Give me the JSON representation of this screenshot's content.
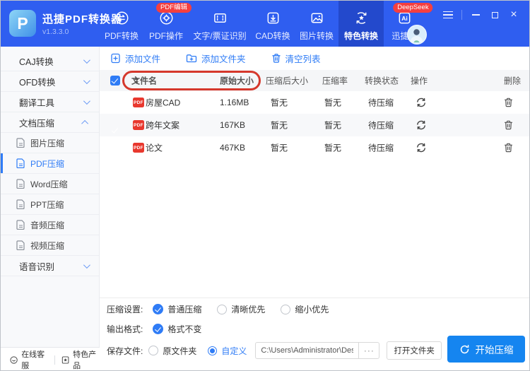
{
  "app": {
    "title": "迅捷PDF转换器",
    "version": "v1.3.3.0",
    "logo_letter": "P"
  },
  "colors": {
    "topbar": "#2f5ef0",
    "active_tab": "#2349cc",
    "accent": "#2f7cf6",
    "badge_red": "#f53f3f",
    "start_button": "#1585f0",
    "annotation_red": "#d5382c"
  },
  "topnav": {
    "items": [
      {
        "label": "PDF转换"
      },
      {
        "label": "PDF操作",
        "badge": "PDF编辑"
      },
      {
        "label": "文字/票证识别"
      },
      {
        "label": "CAD转换"
      },
      {
        "label": "图片转换"
      },
      {
        "label": "特色转换",
        "active": true
      },
      {
        "label": "迅捷AI",
        "badge": "DeepSeek"
      }
    ]
  },
  "sidebar": {
    "groups": [
      {
        "label": "CAJ转换",
        "expanded": false
      },
      {
        "label": "OFD转换",
        "expanded": false
      },
      {
        "label": "翻译工具",
        "expanded": false
      },
      {
        "label": "文档压缩",
        "expanded": true,
        "children": [
          {
            "label": "图片压缩"
          },
          {
            "label": "PDF压缩",
            "selected": true
          },
          {
            "label": "Word压缩"
          },
          {
            "label": "PPT压缩"
          },
          {
            "label": "音频压缩"
          },
          {
            "label": "视频压缩"
          }
        ]
      },
      {
        "label": "语音识别",
        "expanded": false
      }
    ]
  },
  "toolbar": {
    "add_file": "添加文件",
    "add_folder": "添加文件夹",
    "clear_list": "清空列表"
  },
  "table": {
    "headers": {
      "name": "文件名",
      "orig": "原始大小",
      "compressed": "压缩后大小",
      "ratio": "压缩率",
      "status": "转换状态",
      "action": "操作",
      "delete": "删除"
    },
    "rows": [
      {
        "name": "房屋CAD",
        "orig": "1.16MB",
        "compressed": "暂无",
        "ratio": "暂无",
        "status": "待压缩",
        "type": "PDF"
      },
      {
        "name": "跨年文案",
        "orig": "167KB",
        "compressed": "暂无",
        "ratio": "暂无",
        "status": "待压缩",
        "type": "PDF"
      },
      {
        "name": "论文",
        "orig": "467KB",
        "compressed": "暂无",
        "ratio": "暂无",
        "status": "待压缩",
        "type": "PDF"
      }
    ]
  },
  "settings": {
    "compress_label": "压缩设置:",
    "compress_options": [
      {
        "label": "普通压缩",
        "selected": true
      },
      {
        "label": "清晰优先",
        "selected": false
      },
      {
        "label": "缩小优先",
        "selected": false
      }
    ],
    "format_label": "输出格式:",
    "format_options": [
      {
        "label": "格式不变",
        "selected": true
      }
    ],
    "save_label": "保存文件:",
    "save_options": [
      {
        "label": "原文件夹",
        "selected": false
      },
      {
        "label": "自定义",
        "selected": true
      }
    ],
    "path": "C:\\Users\\Administrator\\Desktop",
    "ellipsis": "···",
    "open_folder": "打开文件夹",
    "start": "开始压缩"
  },
  "footer": {
    "support": "在线客服",
    "products": "特色产品"
  }
}
